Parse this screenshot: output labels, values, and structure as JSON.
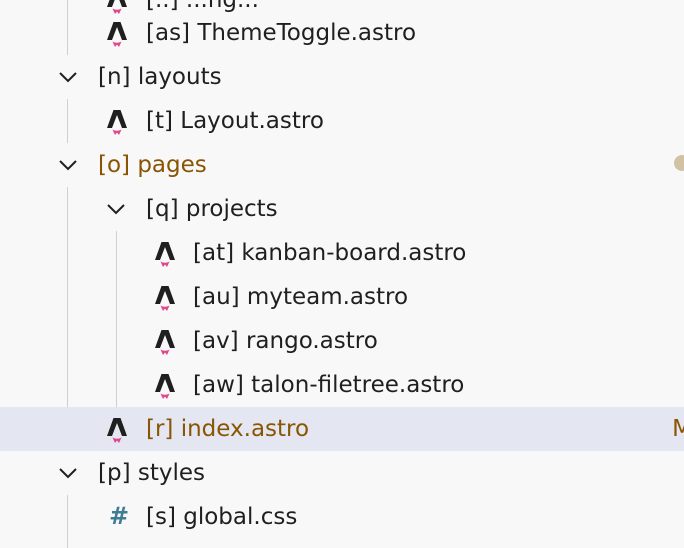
{
  "colors": {
    "background": "#f8f8f8",
    "selected_row": "#e4e6f1",
    "modified_text": "#895503",
    "guide_line": "#cfcfcf",
    "astro_icon": "#1f1f1f",
    "astro_flame": "#e0458b",
    "css_icon": "#3e7b94",
    "dot": "#d2c2a4"
  },
  "tree": {
    "top_partial": {
      "label": "[..] ...ng...",
      "icon": "astro-icon"
    },
    "theme_toggle": {
      "label": "[as] ThemeToggle.astro",
      "icon": "astro-icon"
    },
    "layouts": {
      "label": "[n] layouts",
      "icon": "chevron-down-icon",
      "expanded": true
    },
    "layout_file": {
      "label": "[t] Layout.astro",
      "icon": "astro-icon"
    },
    "pages": {
      "label": "[o] pages",
      "icon": "chevron-down-icon",
      "expanded": true,
      "modified": true
    },
    "projects": {
      "label": "[q] projects",
      "icon": "chevron-down-icon",
      "expanded": true
    },
    "kanban": {
      "label": "[at] kanban-board.astro",
      "icon": "astro-icon"
    },
    "myteam": {
      "label": "[au] myteam.astro",
      "icon": "astro-icon"
    },
    "rango": {
      "label": "[av] rango.astro",
      "icon": "astro-icon"
    },
    "talon": {
      "label": "[aw] talon-filetree.astro",
      "icon": "astro-icon"
    },
    "index": {
      "label": "[r] index.astro",
      "icon": "astro-icon",
      "modified": true,
      "selected": true,
      "badge": "M"
    },
    "styles": {
      "label": "[p] styles",
      "icon": "chevron-down-icon",
      "expanded": true
    },
    "global_css": {
      "label": "[s] global.css",
      "icon": "hash-icon"
    }
  }
}
